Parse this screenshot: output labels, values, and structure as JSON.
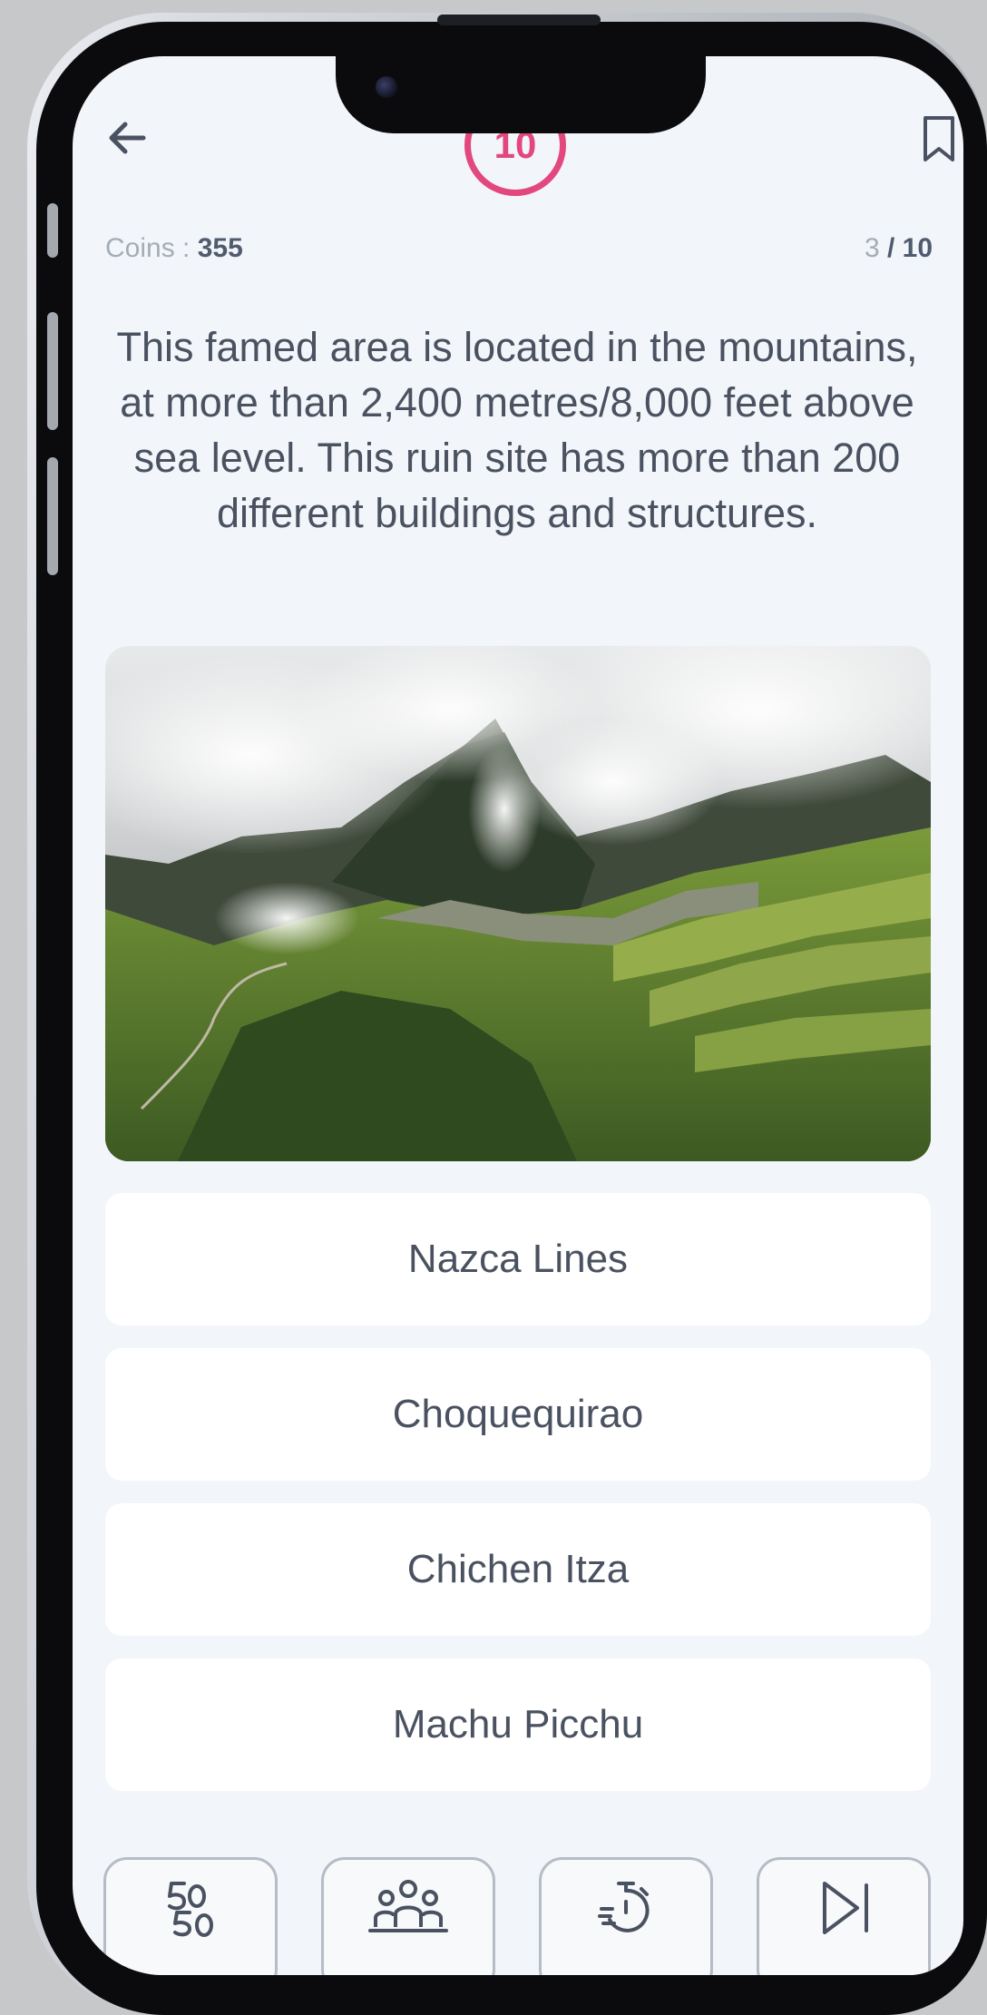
{
  "header": {
    "timer_value": "10",
    "coins_label": "Coins : ",
    "coins_value": "355",
    "progress_current": "3",
    "progress_total": " / 10"
  },
  "question": {
    "text": "This famed area is located in the mountains, at more than 2,400 metres/8,000 feet above sea level. This ruin site has more than 200 different buildings and structures."
  },
  "answers": [
    {
      "label": "Nazca Lines"
    },
    {
      "label": "Choquequirao"
    },
    {
      "label": "Chichen Itza"
    },
    {
      "label": "Machu Picchu"
    }
  ],
  "lifelines": [
    {
      "icon": "fifty-fifty-icon"
    },
    {
      "icon": "audience-poll-icon"
    },
    {
      "icon": "timer-icon"
    },
    {
      "icon": "skip-icon"
    }
  ],
  "colors": {
    "accent": "#e2477e",
    "background": "#f2f5f9",
    "text": "#4a5160"
  }
}
